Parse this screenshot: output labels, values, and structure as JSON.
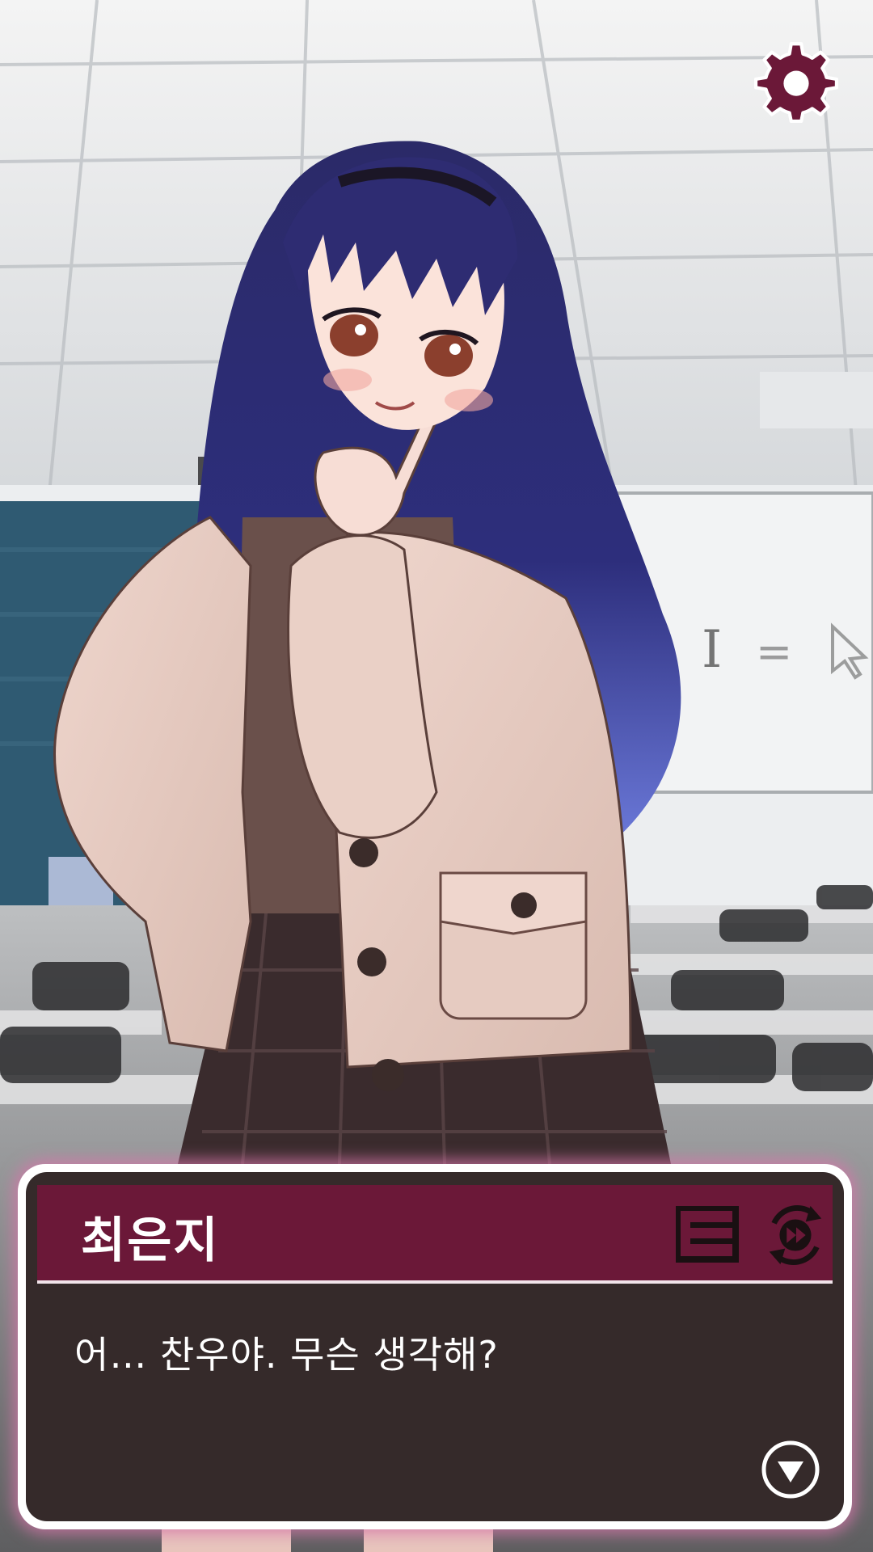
{
  "ui": {
    "settings_icon": "gear-icon",
    "log_icon": "log-list-icon",
    "auto_icon": "auto-skip-icon",
    "next_icon": "down-triangle-icon",
    "accent_color": "#6b1838",
    "glow_color": "#d676aa"
  },
  "dialogue": {
    "speaker": "최은지",
    "text": "어… 찬우야. 무슨 생각해?"
  }
}
